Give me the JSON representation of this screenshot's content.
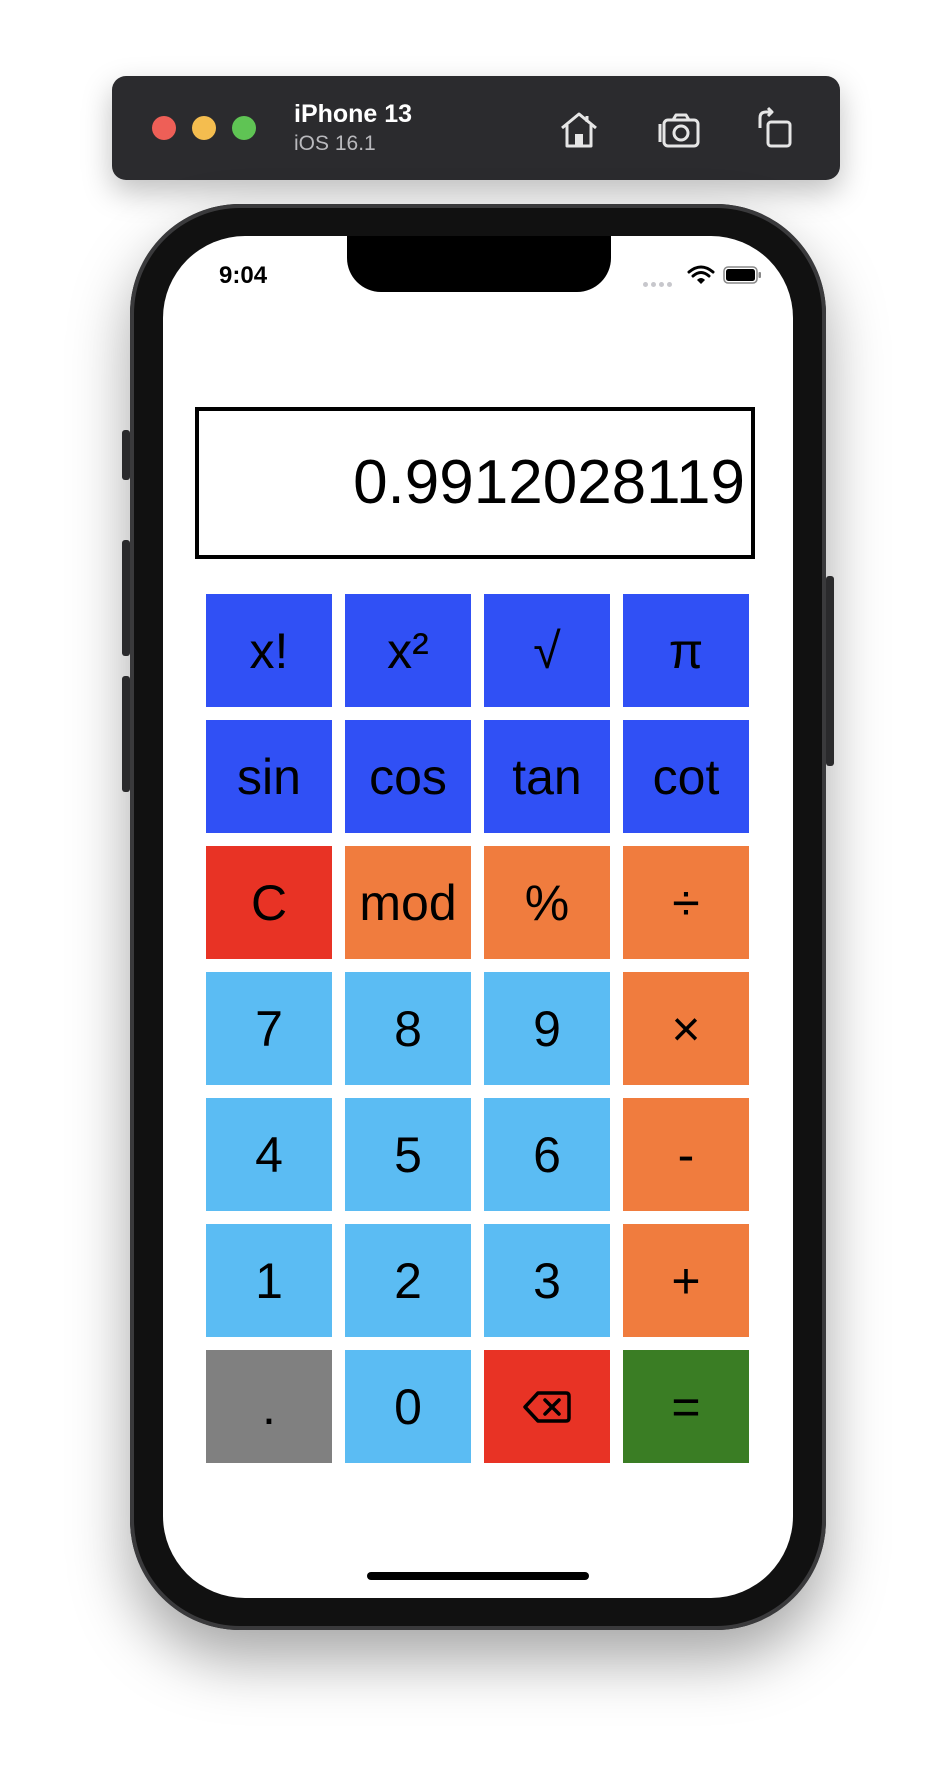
{
  "simulator": {
    "device_name": "iPhone 13",
    "os_version": "iOS 16.1",
    "icons": [
      "home-icon",
      "screenshot-icon",
      "rotate-icon"
    ]
  },
  "status_bar": {
    "time": "9:04",
    "icons": [
      "cellular-icon",
      "wifi-icon",
      "battery-icon"
    ]
  },
  "display": {
    "value": "0.9912028119"
  },
  "keys": [
    {
      "label": "x!",
      "color": "#3050f5"
    },
    {
      "label": "x²",
      "color": "#3050f5"
    },
    {
      "label": "√",
      "color": "#3050f5"
    },
    {
      "label": "π",
      "color": "#3050f5"
    },
    {
      "label": "sin",
      "color": "#3050f5"
    },
    {
      "label": "cos",
      "color": "#3050f5"
    },
    {
      "label": "tan",
      "color": "#3050f5"
    },
    {
      "label": "cot",
      "color": "#3050f5"
    },
    {
      "label": "C",
      "color": "#e83325"
    },
    {
      "label": "mod",
      "color": "#f07c3e"
    },
    {
      "label": "%",
      "color": "#f07c3e"
    },
    {
      "label": "÷",
      "color": "#f07c3e"
    },
    {
      "label": "7",
      "color": "#5bbcf3"
    },
    {
      "label": "8",
      "color": "#5bbcf3"
    },
    {
      "label": "9",
      "color": "#5bbcf3"
    },
    {
      "label": "×",
      "color": "#f07c3e"
    },
    {
      "label": "4",
      "color": "#5bbcf3"
    },
    {
      "label": "5",
      "color": "#5bbcf3"
    },
    {
      "label": "6",
      "color": "#5bbcf3"
    },
    {
      "label": "-",
      "color": "#f07c3e"
    },
    {
      "label": "1",
      "color": "#5bbcf3"
    },
    {
      "label": "2",
      "color": "#5bbcf3"
    },
    {
      "label": "3",
      "color": "#5bbcf3"
    },
    {
      "label": "+",
      "color": "#f07c3e"
    },
    {
      "label": ".",
      "color": "#808080"
    },
    {
      "label": "0",
      "color": "#5bbcf3"
    },
    {
      "label": "",
      "icon": "backspace-icon",
      "color": "#e83325"
    },
    {
      "label": "=",
      "color": "#3a7d24"
    }
  ]
}
